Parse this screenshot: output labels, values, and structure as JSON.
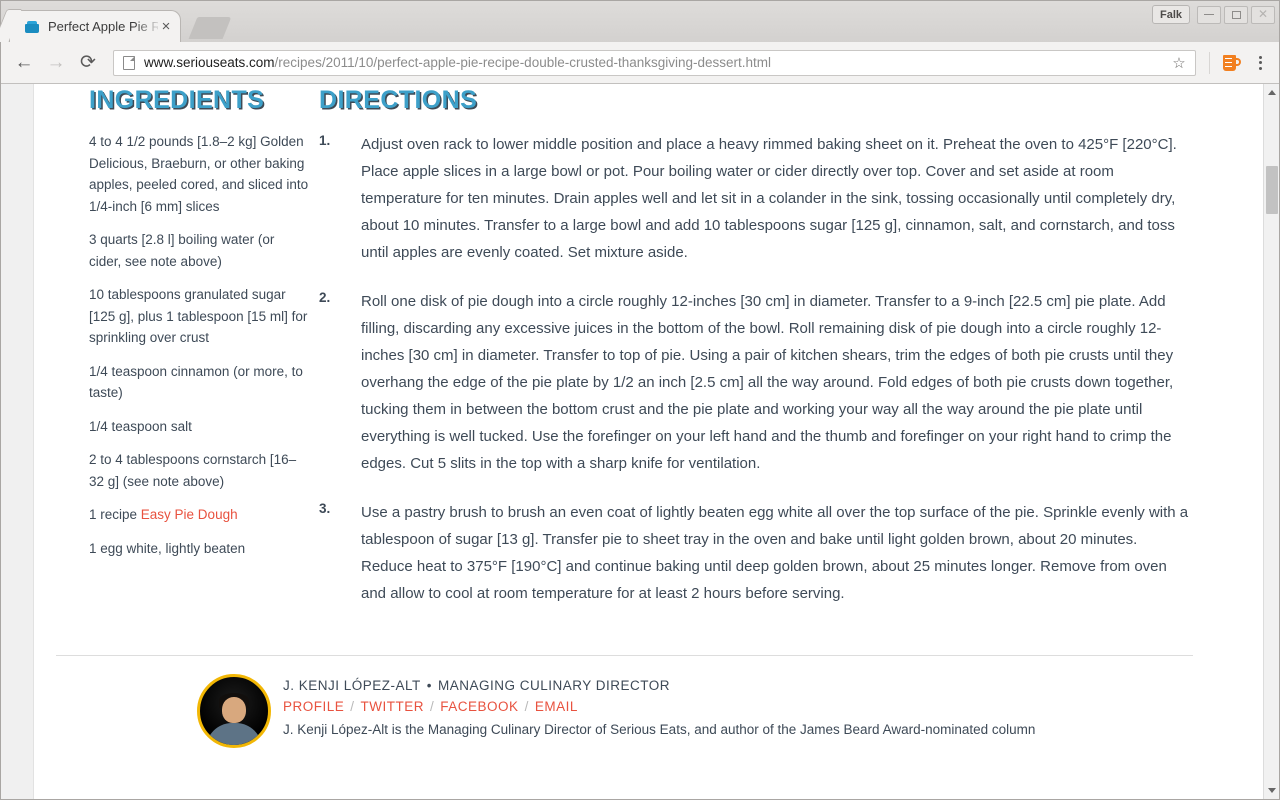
{
  "window": {
    "profile_button_label": "Falk",
    "minimize_label": "Minimize",
    "maximize_label": "Maximize",
    "close_label": "Close"
  },
  "tabs": [
    {
      "title": "Perfect Apple Pie R",
      "close_label": "×",
      "favicon": "pie-tin-icon"
    }
  ],
  "toolbar": {
    "back_glyph": "←",
    "forward_glyph": "→",
    "reload_glyph": "⟳",
    "url_host": "www.seriouseats.com",
    "url_path": "/recipes/2011/10/perfect-apple-pie-recipe-double-crusted-thanksgiving-dessert.html",
    "bookmark_glyph": "☆",
    "extension_name": "measuring-cup-extension",
    "menu_name": "chrome-menu"
  },
  "page": {
    "ingredients": {
      "heading": "INGREDIENTS",
      "items": [
        {
          "text": "4 to 4 1/2 pounds [1.8–2 kg] Golden Delicious, Braeburn, or other baking apples, peeled cored, and sliced into 1/4-inch [6 mm] slices"
        },
        {
          "text": "3 quarts [2.8 l] boiling water (or cider, see note above)"
        },
        {
          "text": "10 tablespoons granulated sugar [125 g], plus 1 tablespoon [15 ml] for sprinkling over crust"
        },
        {
          "text": "1/4 teaspoon cinnamon (or more, to taste)"
        },
        {
          "text": "1/4 teaspoon salt"
        },
        {
          "text": "2 to 4 tablespoons cornstarch [16–32 g] (see note above)"
        },
        {
          "prefix": "1 recipe ",
          "link": "Easy Pie Dough"
        },
        {
          "text": "1 egg white, lightly beaten"
        }
      ]
    },
    "directions": {
      "heading": "DIRECTIONS",
      "steps": [
        {
          "number": "1.",
          "text": "Adjust oven rack to lower middle position and place a heavy rimmed baking sheet on it. Preheat the oven to 425°F [220°C]. Place apple slices in a large bowl or pot. Pour boiling water or cider directly over top. Cover and set aside at room temperature for ten minutes. Drain apples well and let sit in a colander in the sink, tossing occasionally until completely dry, about 10 minutes. Transfer to a large bowl and add 10 tablespoons sugar [125 g], cinnamon, salt, and cornstarch, and toss until apples are evenly coated. Set mixture aside."
        },
        {
          "number": "2.",
          "text": "Roll one disk of pie dough into a circle roughly 12-inches [30 cm] in diameter. Transfer to a 9-inch [22.5 cm] pie plate. Add filling, discarding any excessive juices in the bottom of the bowl. Roll remaining disk of pie dough into a circle roughly 12-inches [30 cm] in diameter. Transfer to top of pie. Using a pair of kitchen shears, trim the edges of both pie crusts until they overhang the edge of the pie plate by 1/2 an inch [2.5 cm] all the way around. Fold edges of both pie crusts down together, tucking them in between the bottom crust and the pie plate and working your way all the way around the pie plate until everything is well tucked. Use the forefinger on your left hand and the thumb and forefinger on your right hand to crimp the edges. Cut 5 slits in the top with a sharp knife for ventilation."
        },
        {
          "number": "3.",
          "text": "Use a pastry brush to brush an even coat of lightly beaten egg white all over the top surface of the pie. Sprinkle evenly with a tablespoon of sugar [13 g]. Transfer pie to sheet tray in the oven and bake until light golden brown, about 20 minutes. Reduce heat to 375°F [190°C] and continue baking until deep golden brown, about 25 minutes longer. Remove from oven and allow to cool at room temperature for at least 2 hours before serving."
        }
      ]
    },
    "author": {
      "name": "J. KENJI LÓPEZ-ALT",
      "separator": "•",
      "role": "MANAGING CULINARY DIRECTOR",
      "links": [
        "PROFILE",
        "TWITTER",
        "FACEBOOK",
        "EMAIL"
      ],
      "link_separator": "/",
      "bio": "J. Kenji López-Alt is the Managing Culinary Director of Serious Eats, and author of the James Beard Award-nominated column"
    }
  },
  "colors": {
    "heading_blue": "#3da0c9",
    "heading_shadow": "#3e4a55",
    "body_text": "#3e4a57",
    "link_red": "#e8523f",
    "avatar_ring": "#f2b705",
    "extension_orange": "#f28020"
  }
}
